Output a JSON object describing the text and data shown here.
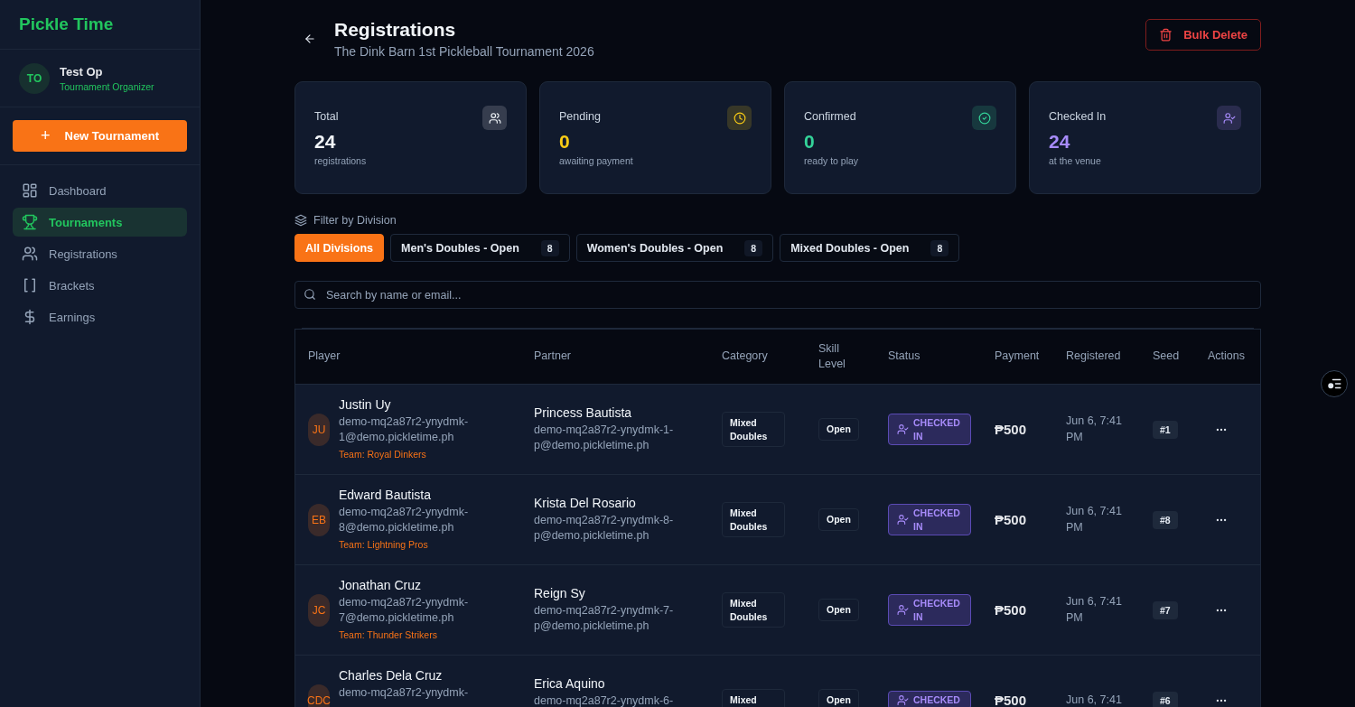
{
  "sidebar": {
    "brand": "Pickle Time",
    "user": {
      "initials": "TO",
      "name": "Test Op",
      "role": "Tournament Organizer"
    },
    "new_button": {
      "icon": "+",
      "label": "New Tournament"
    },
    "nav": [
      {
        "label": "Dashboard",
        "selected": false
      },
      {
        "label": "Tournaments",
        "selected": true
      },
      {
        "label": "Registrations",
        "selected": false
      },
      {
        "label": "Brackets",
        "selected": false
      },
      {
        "label": "Earnings",
        "selected": false
      }
    ]
  },
  "header": {
    "title": "Registrations",
    "subtitle": "The Dink Barn 1st Pickleball Tournament 2026",
    "bulk_delete": "Bulk Delete"
  },
  "stats": [
    {
      "label": "Total",
      "value": "24",
      "caption": "registrations",
      "color": "#f1f5f9"
    },
    {
      "label": "Pending",
      "value": "0",
      "caption": "awaiting payment",
      "color": "#facc15"
    },
    {
      "label": "Confirmed",
      "value": "0",
      "caption": "ready to play",
      "color": "#34d399"
    },
    {
      "label": "Checked In",
      "value": "24",
      "caption": "at the venue",
      "color": "#a78bfa"
    }
  ],
  "filter": {
    "label": "Filter by Division",
    "chips": [
      {
        "label": "All Divisions",
        "selected": true
      },
      {
        "label": "Men's Doubles - Open",
        "count": "8",
        "selected": false
      },
      {
        "label": "Women's Doubles - Open",
        "count": "8",
        "selected": false
      },
      {
        "label": "Mixed Doubles - Open",
        "count": "8",
        "selected": false
      }
    ]
  },
  "search": {
    "placeholder": "Search by name or email..."
  },
  "table": {
    "columns": [
      "Player",
      "Partner",
      "Category",
      "Skill Level",
      "Status",
      "Payment",
      "Registered",
      "Seed",
      "Actions"
    ],
    "rows": [
      {
        "initials": "JU",
        "name": "Justin Uy",
        "email": "demo-mq2a87r2-ynydmk-1@demo.pickletime.ph",
        "team": "Team: Royal Dinkers",
        "partner_name": "Princess Bautista",
        "partner_email": "demo-mq2a87r2-ynydmk-1-p@demo.pickletime.ph",
        "category": "Mixed Doubles",
        "skill": "Open",
        "status": "CHECKED IN",
        "payment": "₱500",
        "registered": "Jun 6, 7:41 PM",
        "seed": "#1"
      },
      {
        "initials": "EB",
        "name": "Edward Bautista",
        "email": "demo-mq2a87r2-ynydmk-8@demo.pickletime.ph",
        "team": "Team: Lightning Pros",
        "partner_name": "Krista Del Rosario",
        "partner_email": "demo-mq2a87r2-ynydmk-8-p@demo.pickletime.ph",
        "category": "Mixed Doubles",
        "skill": "Open",
        "status": "CHECKED IN",
        "payment": "₱500",
        "registered": "Jun 6, 7:41 PM",
        "seed": "#8"
      },
      {
        "initials": "JC",
        "name": "Jonathan Cruz",
        "email": "demo-mq2a87r2-ynydmk-7@demo.pickletime.ph",
        "team": "Team: Thunder Strikers",
        "partner_name": "Reign Sy",
        "partner_email": "demo-mq2a87r2-ynydmk-7-p@demo.pickletime.ph",
        "category": "Mixed Doubles",
        "skill": "Open",
        "status": "CHECKED IN",
        "payment": "₱500",
        "registered": "Jun 6, 7:41 PM",
        "seed": "#7"
      },
      {
        "initials": "CDC",
        "name": "Charles Dela Cruz",
        "email": "demo-mq2a87r2-ynydmk-",
        "partner_name": "Erica Aquino",
        "partner_email": "demo-mq2a87r2-ynydmk-6-",
        "category": "Mixed",
        "skill": "Open",
        "status": "CHECKED",
        "payment": "₱500",
        "registered": "Jun 6, 7:41",
        "seed": "#6"
      }
    ]
  }
}
